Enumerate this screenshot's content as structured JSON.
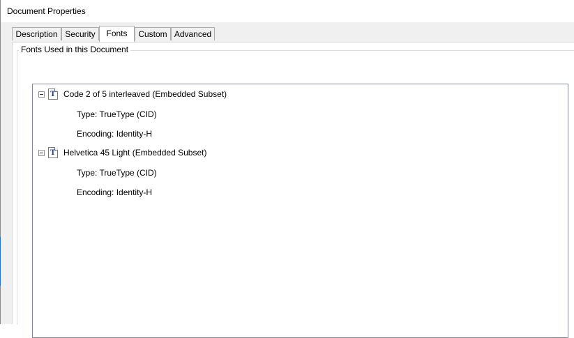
{
  "window": {
    "title": "Document Properties"
  },
  "tabs": [
    {
      "label": "Description",
      "active": false
    },
    {
      "label": "Security",
      "active": false
    },
    {
      "label": "Fonts",
      "active": true
    },
    {
      "label": "Custom",
      "active": false
    },
    {
      "label": "Advanced",
      "active": false
    }
  ],
  "fonts_panel": {
    "group_title": "Fonts Used in this Document",
    "fonts": [
      {
        "name": "Code 2 of 5 interleaved (Embedded Subset)",
        "icon": "truetype-font-icon",
        "expanded": true,
        "type": "Type: TrueType (CID)",
        "encoding": "Encoding: Identity-H"
      },
      {
        "name": "Helvetica 45 Light (Embedded Subset)",
        "icon": "truetype-font-icon",
        "expanded": true,
        "type": "Type: TrueType (CID)",
        "encoding": "Encoding: Identity-H"
      }
    ]
  }
}
